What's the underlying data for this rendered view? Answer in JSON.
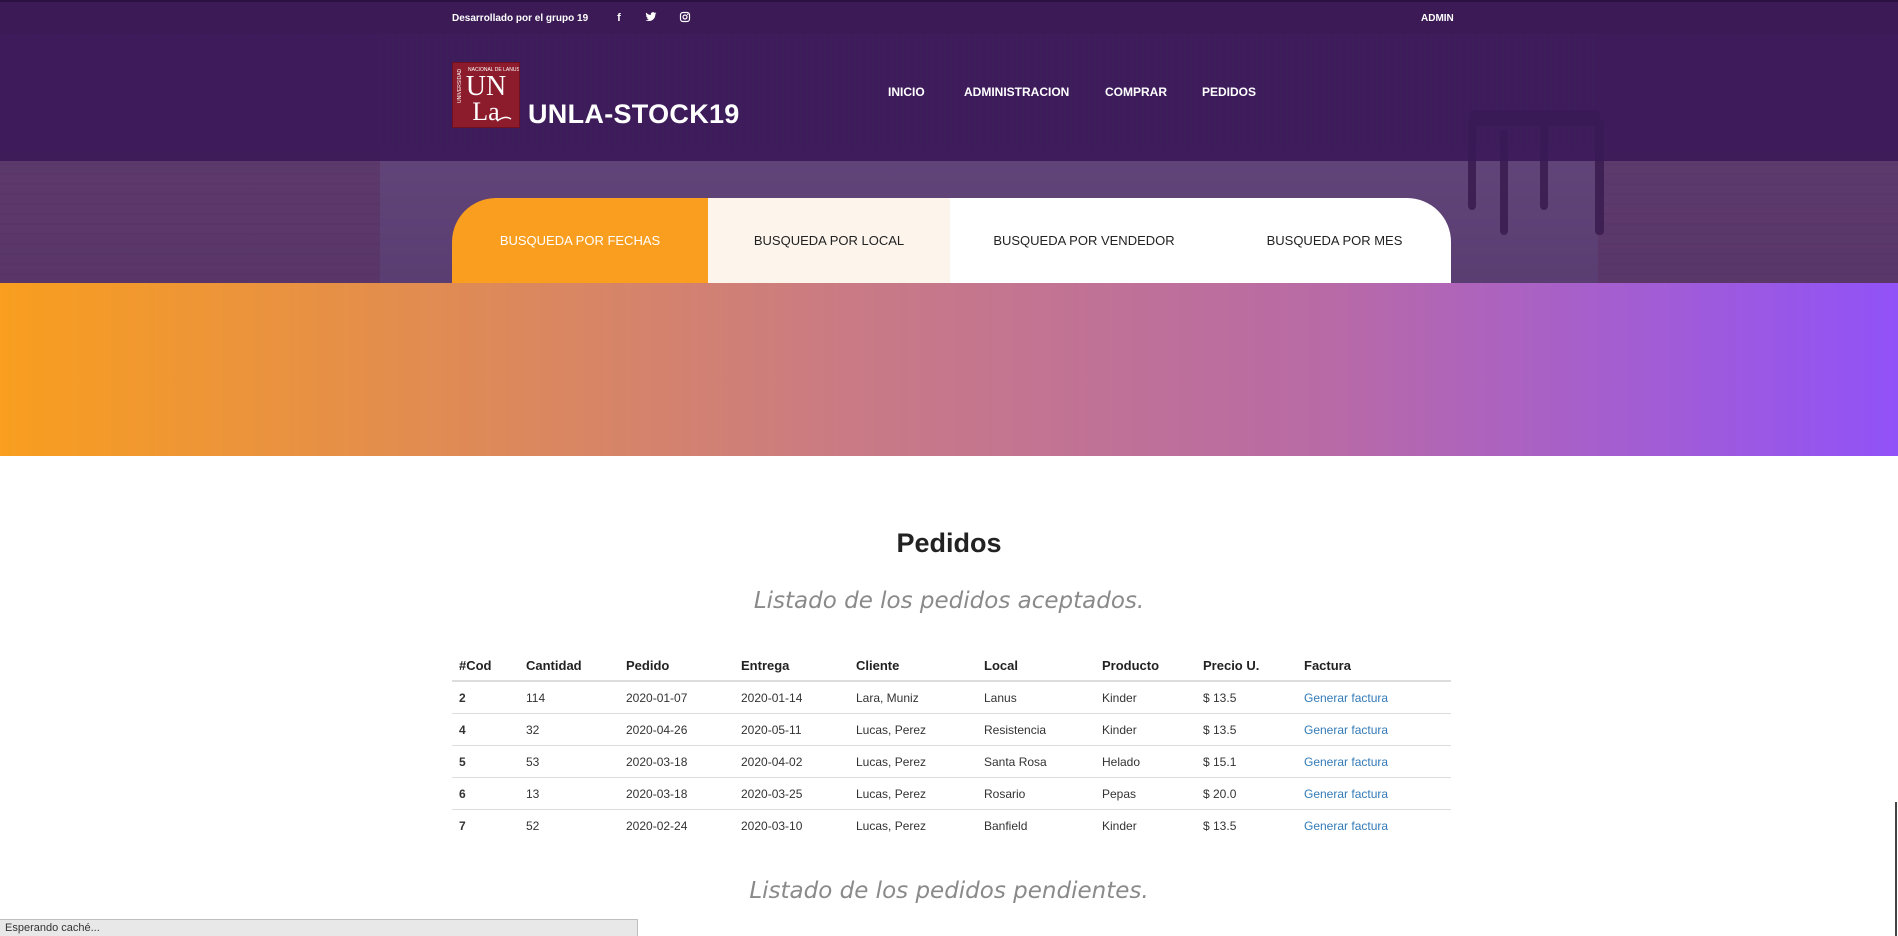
{
  "topbar": {
    "credit": "Desarrollado por el grupo 19",
    "social": [
      {
        "name": "facebook-icon",
        "glyph": "f"
      },
      {
        "name": "twitter-icon",
        "glyph": "🐦"
      },
      {
        "name": "instagram-icon",
        "glyph": "◎"
      }
    ],
    "user": "ADMIN"
  },
  "brand": {
    "logo_text": "UNLa",
    "name": "UNLA-STOCK19"
  },
  "nav": {
    "items": [
      "INICIO",
      "ADMINISTRACION",
      "COMPRAR",
      "PEDIDOS"
    ]
  },
  "tabs": [
    {
      "label": "BUSQUEDA POR FECHAS",
      "active": true
    },
    {
      "label": "BUSQUEDA POR LOCAL"
    },
    {
      "label": "BUSQUEDA POR VENDEDOR"
    },
    {
      "label": "BUSQUEDA POR MES"
    }
  ],
  "colors": {
    "accent_orange": "#f99e1e",
    "accent_purple": "#9152f8",
    "header_purple": "#3b1a55",
    "link_blue": "#337ab7"
  },
  "main": {
    "title": "Pedidos",
    "accepted_subtitle": "Listado de los pedidos aceptados.",
    "pending_subtitle": "Listado de los pedidos pendientes."
  },
  "table": {
    "headers": [
      "#Cod",
      "Cantidad",
      "Pedido",
      "Entrega",
      "Cliente",
      "Local",
      "Producto",
      "Precio U.",
      "Factura"
    ],
    "rows": [
      [
        "2",
        "114",
        "2020-01-07",
        "2020-01-14",
        "Lara, Muniz",
        "Lanus",
        "Kinder",
        "$ 13.5",
        "Generar factura"
      ],
      [
        "4",
        "32",
        "2020-04-26",
        "2020-05-11",
        "Lucas, Perez",
        "Resistencia",
        "Kinder",
        "$ 13.5",
        "Generar factura"
      ],
      [
        "5",
        "53",
        "2020-03-18",
        "2020-04-02",
        "Lucas, Perez",
        "Santa Rosa",
        "Helado",
        "$ 15.1",
        "Generar factura"
      ],
      [
        "6",
        "13",
        "2020-03-18",
        "2020-03-25",
        "Lucas, Perez",
        "Rosario",
        "Pepas",
        "$ 20.0",
        "Generar factura"
      ],
      [
        "7",
        "52",
        "2020-02-24",
        "2020-03-10",
        "Lucas, Perez",
        "Banfield",
        "Kinder",
        "$ 13.5",
        "Generar factura"
      ]
    ]
  },
  "statusbar": {
    "text": "Esperando caché..."
  }
}
